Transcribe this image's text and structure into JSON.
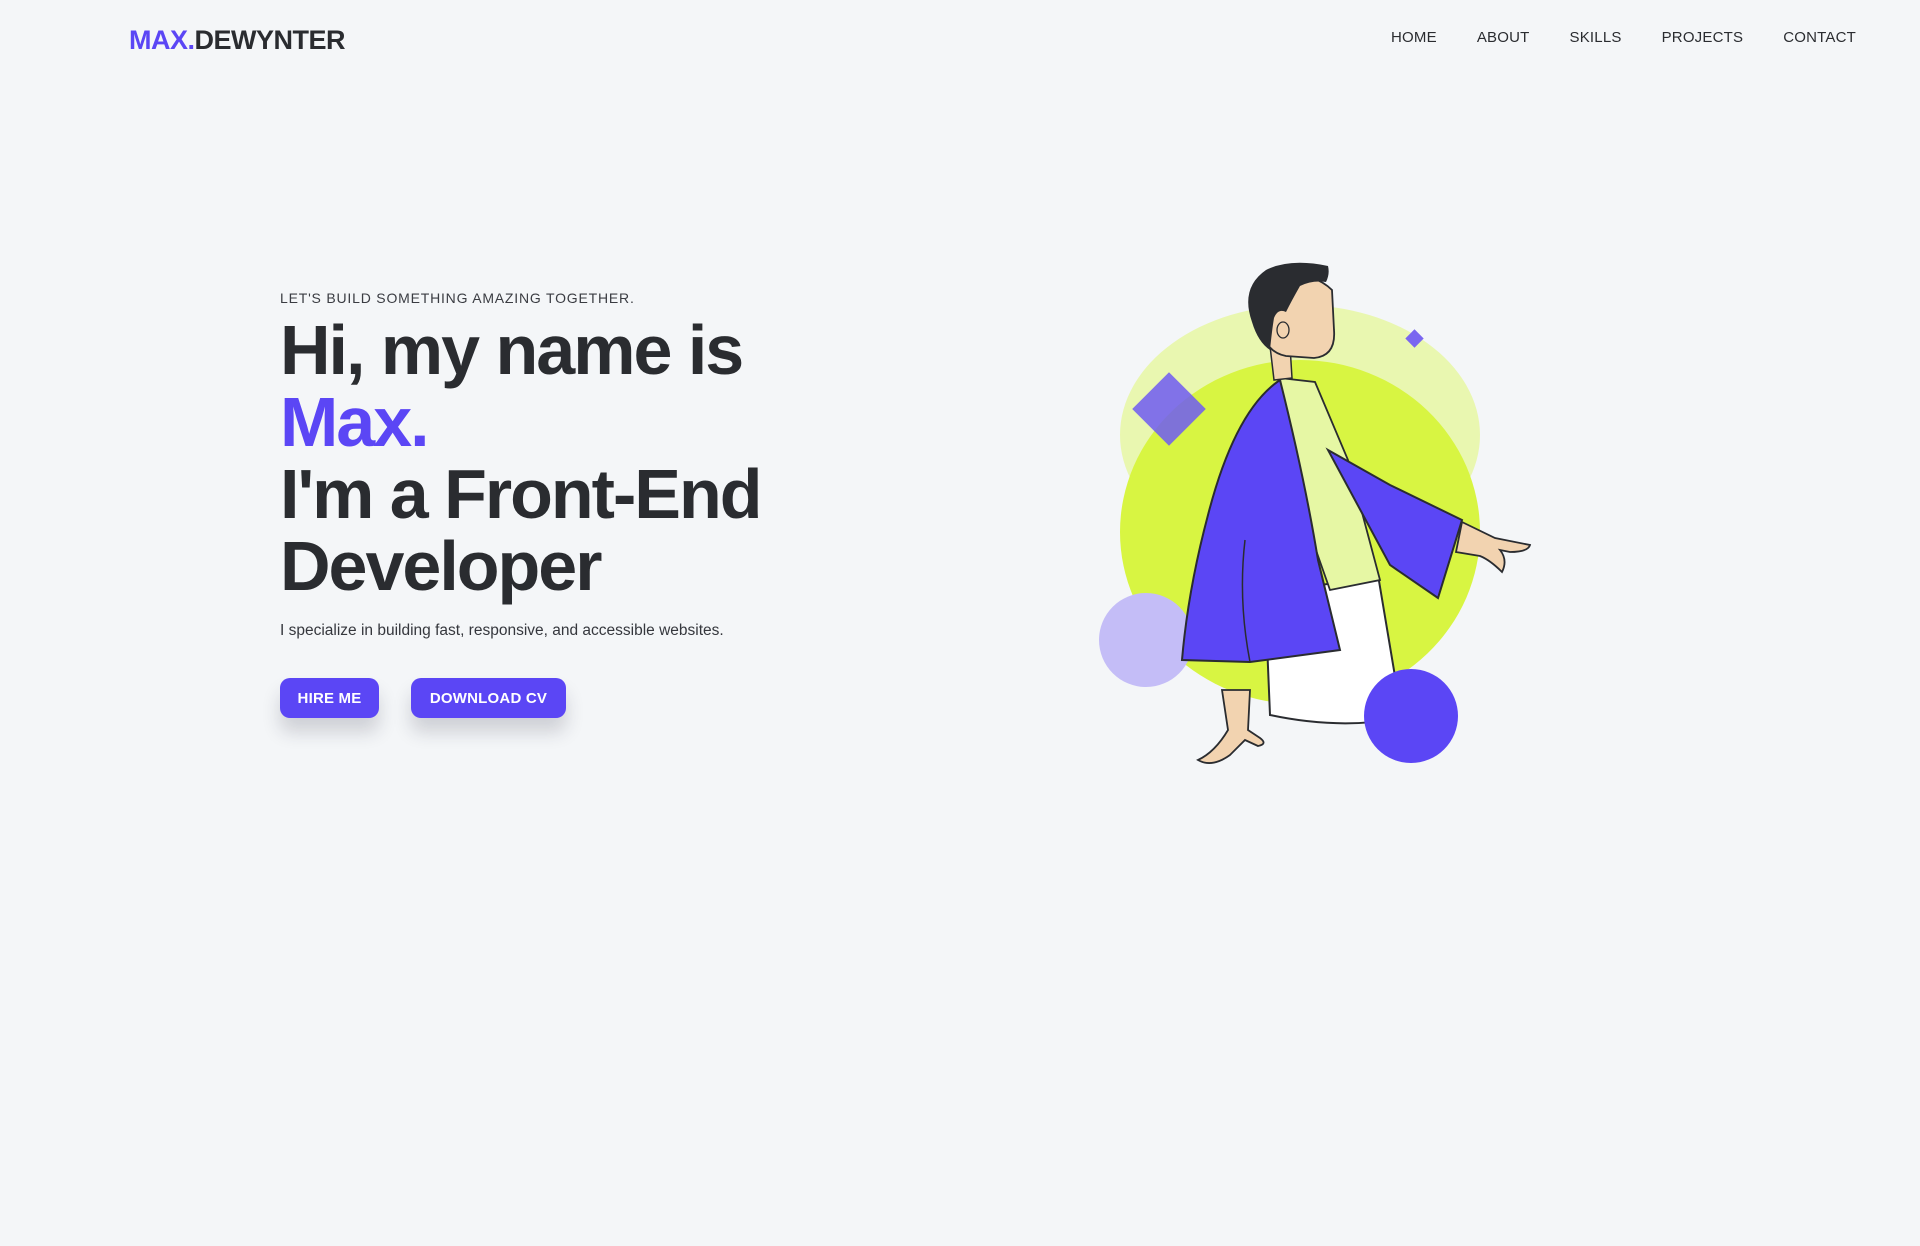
{
  "header": {
    "logo_brand": "MAX.",
    "logo_rest": "DEWYNTER",
    "nav": [
      {
        "label": "HOME"
      },
      {
        "label": "ABOUT"
      },
      {
        "label": "SKILLS"
      },
      {
        "label": "PROJECTS"
      },
      {
        "label": "CONTACT"
      }
    ]
  },
  "hero": {
    "kicker": "LET'S BUILD SOMETHING AMAZING TOGETHER.",
    "headline_line1": "Hi, my name is",
    "headline_name": "Max.",
    "headline_line3": "I'm a Front-End",
    "headline_line4": "Developer",
    "subtitle": "I specialize in building fast, responsive, and accessible websites.",
    "buttons": {
      "hire": "HIRE ME",
      "cv": "DOWNLOAD CV"
    }
  },
  "colors": {
    "background": "#f4f6f8",
    "accent": "#5b46f5",
    "text": "#2a2c30",
    "lime": "#d8f542"
  },
  "icons": {
    "illustration": "developer-character-illustration"
  }
}
